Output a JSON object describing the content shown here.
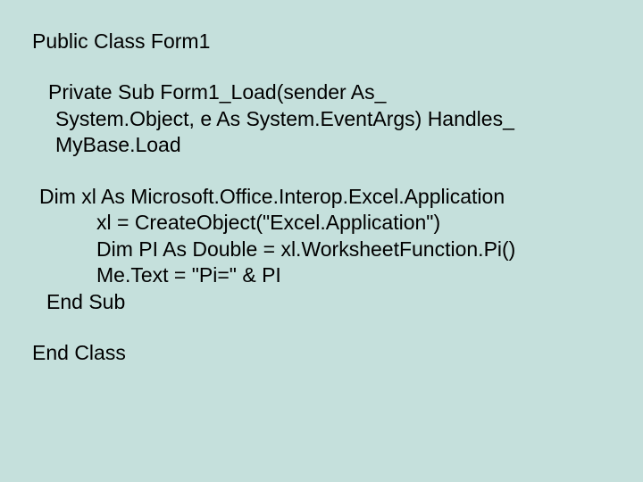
{
  "code": {
    "class_open": "Public Class Form1",
    "sub_sig_1": "Private Sub Form1_Load(sender As_",
    "sub_sig_2": "System.Object, e As System.EventArgs) Handles_",
    "sub_sig_3": "MyBase.Load",
    "dim_xl": "Dim xl As Microsoft.Office.Interop.Excel.Application",
    "assign_xl": "xl = CreateObject(\"Excel.Application\")",
    "dim_pi": "Dim PI As Double = xl.WorksheetFunction.Pi()",
    "me_text": "Me.Text = \"Pi=\" & PI",
    "end_sub": "End Sub",
    "class_close": "End Class"
  }
}
